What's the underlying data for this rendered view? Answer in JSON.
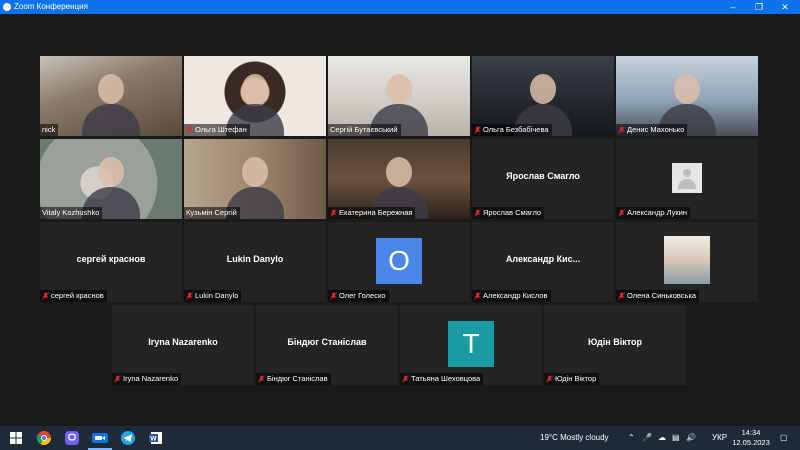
{
  "window": {
    "title": "Zoom Конференция"
  },
  "participants": [
    {
      "name": "nick",
      "muted": false
    },
    {
      "name": "Ольга Штефан",
      "muted": true
    },
    {
      "name": "Сергій Бутаєвський",
      "muted": false
    },
    {
      "name": "Ольга Безбабічева",
      "muted": true
    },
    {
      "name": "Денис Махонько",
      "muted": true
    },
    {
      "name": "Vitaly Kozhushko",
      "muted": false,
      "active_speaker": true
    },
    {
      "name": "Кузьмін Сергій",
      "muted": false
    },
    {
      "name": "Екатерина Бережная",
      "muted": true
    },
    {
      "name": "Ярослав Смагло",
      "muted": true,
      "display": "Ярослав Смагло"
    },
    {
      "name": "Александр Лукин",
      "muted": true,
      "avatar": "default-avatar"
    },
    {
      "name": "сергей краснов",
      "muted": true,
      "display": "сергей краснов"
    },
    {
      "name": "Lukin Danylo",
      "muted": true,
      "display": "Lukin Danylo"
    },
    {
      "name": "Олег Голеско",
      "muted": true,
      "avatar_letter": "O",
      "avatar_color": "#4a86e8"
    },
    {
      "name": "Александр Кислов",
      "muted": true,
      "display": "Александр  Кис..."
    },
    {
      "name": "Олена Синьковська",
      "muted": true
    },
    {
      "name": "Iryna Nazarenko",
      "muted": true,
      "display": "Iryna Nazarenko"
    },
    {
      "name": "Біндюг Станіслав",
      "muted": true,
      "display": "Біндюг Станіслав"
    },
    {
      "name": "Татьяна Шеховцова",
      "muted": true,
      "avatar_letter": "T",
      "avatar_color": "#1a9ba1"
    },
    {
      "name": "Юдін Віктор",
      "muted": true,
      "display": "Юдін Віктор"
    }
  ],
  "taskbar": {
    "weather": "19°C  Mostly cloudy",
    "language": "УКР",
    "time": "14:34",
    "date": "12.05.2023",
    "apps": [
      "windows-start",
      "chrome",
      "viber",
      "zoom",
      "telegram",
      "word"
    ]
  },
  "colors": {
    "zoom_blue": "#0e72ed",
    "tile_bg": "#242424",
    "stage_bg": "#1a1a1a",
    "mute_red": "#e02828",
    "active_speaker": "#9acd32"
  }
}
